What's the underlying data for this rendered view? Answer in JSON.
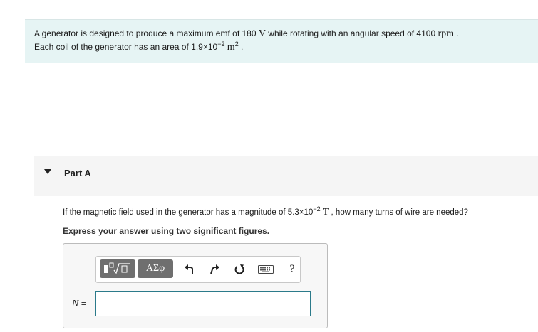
{
  "problem": {
    "line1": {
      "t1": "A generator is designed to produce a maximum emf of 180 ",
      "u1": "V",
      "t2": " while rotating with an angular speed of 4100 ",
      "u2": "rpm",
      "t3": " ."
    },
    "line2": {
      "t1": "Each coil of the generator has an area of 1.9×10",
      "exp": "−2",
      "t2": " ",
      "u1": "m",
      "u1exp": "2",
      "t3": " ."
    }
  },
  "part": {
    "title": "Part A",
    "question": {
      "t1": "If the magnetic field used in the generator has a magnitude of 5.3×10",
      "exp": "−2",
      "t2": " ",
      "unit": "T",
      "t3": " , how many turns of wire are needed?"
    },
    "instruction": "Express your answer using two significant figures."
  },
  "toolbar": {
    "greek_label": "ΑΣφ",
    "help_label": "?",
    "icons": [
      "templates-icon",
      "greek-symbols-icon",
      "undo-icon",
      "redo-icon",
      "reset-icon",
      "keyboard-icon",
      "help-icon"
    ]
  },
  "answer": {
    "variable": "N",
    "equals": "=",
    "value": "",
    "placeholder": ""
  },
  "colors": {
    "problem_bg": "#e6f4f4",
    "toolbar_button": "#6f6f6f",
    "input_border": "#2b7a8a"
  }
}
